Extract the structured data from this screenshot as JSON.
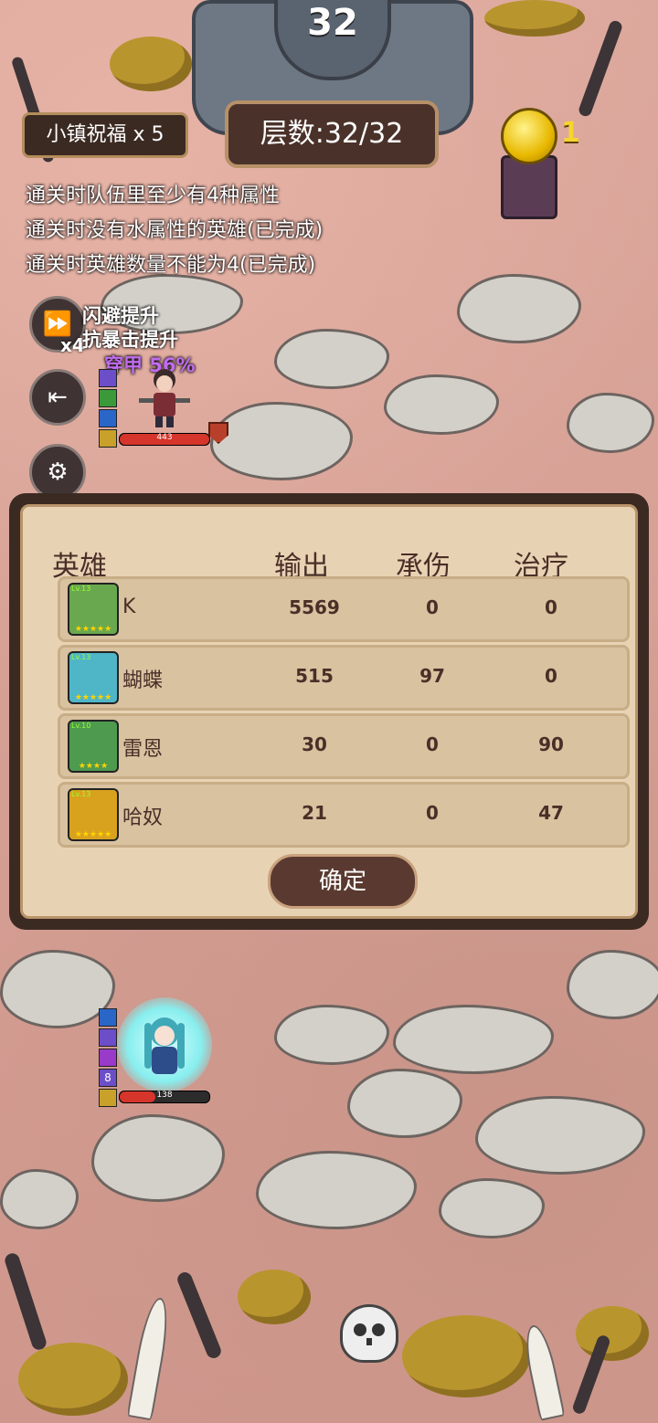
{
  "hud": {
    "floor_dial": "32",
    "blessing": "小镇祝福 x 5",
    "floor_label": "层数:32/32",
    "coin_count": "1"
  },
  "tasks": [
    "通关时队伍里至少有4种属性",
    "通关时没有水属性的英雄(已完成)",
    "通关时英雄数量不能为4(已完成)"
  ],
  "controls": {
    "speed_multiplier": "x4"
  },
  "battle": {
    "buff_1": "闪避提升",
    "buff_2": "抗暴击提升",
    "buff_3": "穿甲 56%",
    "enemy_hp_text": "443",
    "ally_hp_text": "138",
    "ally_level_badge": "8"
  },
  "results": {
    "headers": {
      "hero": "英雄",
      "damage": "输出",
      "tank": "承伤",
      "heal": "治疗"
    },
    "rows": [
      {
        "name": "K",
        "damage": "5569",
        "tank": "0",
        "heal": "0",
        "level": "Lv.13",
        "color": "#6aa84f"
      },
      {
        "name": "蝴蝶",
        "damage": "515",
        "tank": "97",
        "heal": "0",
        "level": "Lv.13",
        "color": "#4fb6c8"
      },
      {
        "name": "雷恩",
        "damage": "30",
        "tank": "0",
        "heal": "90",
        "level": "Lv.10",
        "color": "#4e9a4f"
      },
      {
        "name": "哈奴",
        "damage": "21",
        "tank": "0",
        "heal": "47",
        "level": "Lv.13",
        "color": "#d9a21e"
      }
    ],
    "confirm_label": "确定"
  },
  "icons": [
    "fast-forward-icon",
    "exit-icon",
    "gear-icon",
    "coin-icon",
    "skull-icon"
  ]
}
